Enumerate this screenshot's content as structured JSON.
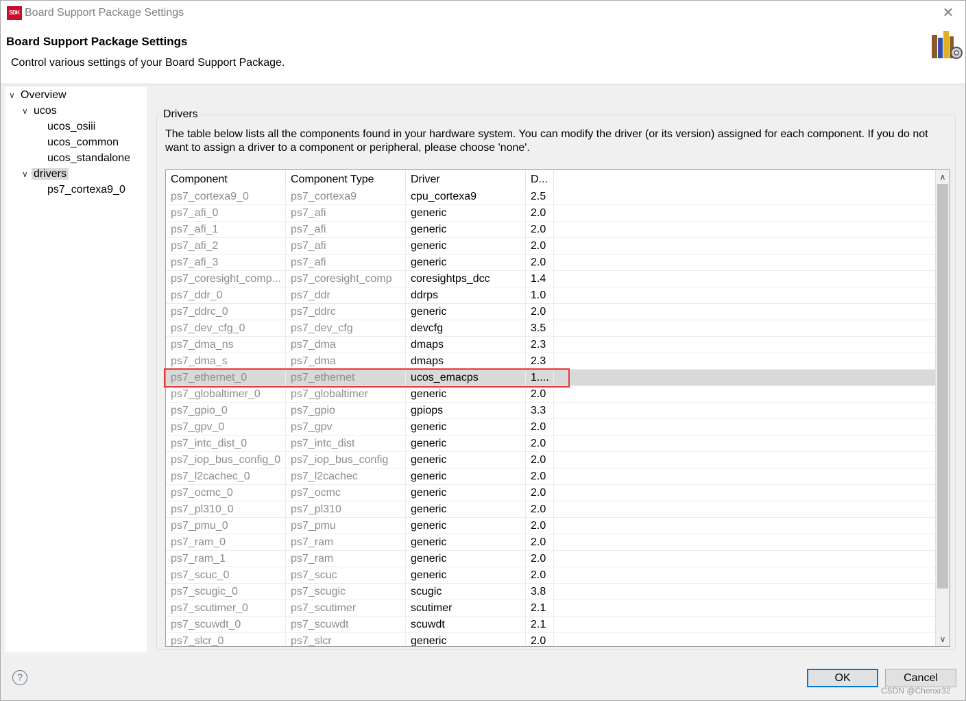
{
  "window": {
    "logo_text": "SDK",
    "title": "Board Support Package Settings",
    "close_glyph": "✕"
  },
  "header": {
    "title": "Board Support Package Settings",
    "description": "Control various settings of your Board Support Package."
  },
  "tree": {
    "items": [
      {
        "label": "Overview",
        "expanded": true
      },
      {
        "label": "ucos",
        "expanded": true
      },
      {
        "label": "ucos_osiii"
      },
      {
        "label": "ucos_common"
      },
      {
        "label": "ucos_standalone"
      },
      {
        "label": "drivers",
        "expanded": true,
        "selected": true
      },
      {
        "label": "ps7_cortexa9_0"
      }
    ]
  },
  "drivers": {
    "group_label": "Drivers",
    "description": "The table below lists all the components found in your hardware system. You can modify the driver (or its version) assigned for each component. If you do not want to assign a driver to a component or peripheral, please choose 'none'.",
    "columns": [
      "Component",
      "Component Type",
      "Driver",
      "D..."
    ],
    "rows": [
      [
        "ps7_cortexa9_0",
        "ps7_cortexa9",
        "cpu_cortexa9",
        "2.5"
      ],
      [
        "ps7_afi_0",
        "ps7_afi",
        "generic",
        "2.0"
      ],
      [
        "ps7_afi_1",
        "ps7_afi",
        "generic",
        "2.0"
      ],
      [
        "ps7_afi_2",
        "ps7_afi",
        "generic",
        "2.0"
      ],
      [
        "ps7_afi_3",
        "ps7_afi",
        "generic",
        "2.0"
      ],
      [
        "ps7_coresight_comp...",
        "ps7_coresight_comp",
        "coresightps_dcc",
        "1.4"
      ],
      [
        "ps7_ddr_0",
        "ps7_ddr",
        "ddrps",
        "1.0"
      ],
      [
        "ps7_ddrc_0",
        "ps7_ddrc",
        "generic",
        "2.0"
      ],
      [
        "ps7_dev_cfg_0",
        "ps7_dev_cfg",
        "devcfg",
        "3.5"
      ],
      [
        "ps7_dma_ns",
        "ps7_dma",
        "dmaps",
        "2.3"
      ],
      [
        "ps7_dma_s",
        "ps7_dma",
        "dmaps",
        "2.3"
      ],
      [
        "ps7_ethernet_0",
        "ps7_ethernet",
        "ucos_emacps",
        "1...."
      ],
      [
        "ps7_globaltimer_0",
        "ps7_globaltimer",
        "generic",
        "2.0"
      ],
      [
        "ps7_gpio_0",
        "ps7_gpio",
        "gpiops",
        "3.3"
      ],
      [
        "ps7_gpv_0",
        "ps7_gpv",
        "generic",
        "2.0"
      ],
      [
        "ps7_intc_dist_0",
        "ps7_intc_dist",
        "generic",
        "2.0"
      ],
      [
        "ps7_iop_bus_config_0",
        "ps7_iop_bus_config",
        "generic",
        "2.0"
      ],
      [
        "ps7_l2cachec_0",
        "ps7_l2cachec",
        "generic",
        "2.0"
      ],
      [
        "ps7_ocmc_0",
        "ps7_ocmc",
        "generic",
        "2.0"
      ],
      [
        "ps7_pl310_0",
        "ps7_pl310",
        "generic",
        "2.0"
      ],
      [
        "ps7_pmu_0",
        "ps7_pmu",
        "generic",
        "2.0"
      ],
      [
        "ps7_ram_0",
        "ps7_ram",
        "generic",
        "2.0"
      ],
      [
        "ps7_ram_1",
        "ps7_ram",
        "generic",
        "2.0"
      ],
      [
        "ps7_scuc_0",
        "ps7_scuc",
        "generic",
        "2.0"
      ],
      [
        "ps7_scugic_0",
        "ps7_scugic",
        "scugic",
        "3.8"
      ],
      [
        "ps7_scutimer_0",
        "ps7_scutimer",
        "scutimer",
        "2.1"
      ],
      [
        "ps7_scuwdt_0",
        "ps7_scuwdt",
        "scuwdt",
        "2.1"
      ],
      [
        "ps7_slcr_0",
        "ps7_slcr",
        "generic",
        "2.0"
      ]
    ],
    "selected_row_index": 11,
    "highlight_color": "#e53935"
  },
  "footer": {
    "help_glyph": "?",
    "ok_label": "OK",
    "cancel_label": "Cancel",
    "watermark": "CSDN @Chenxr32"
  }
}
